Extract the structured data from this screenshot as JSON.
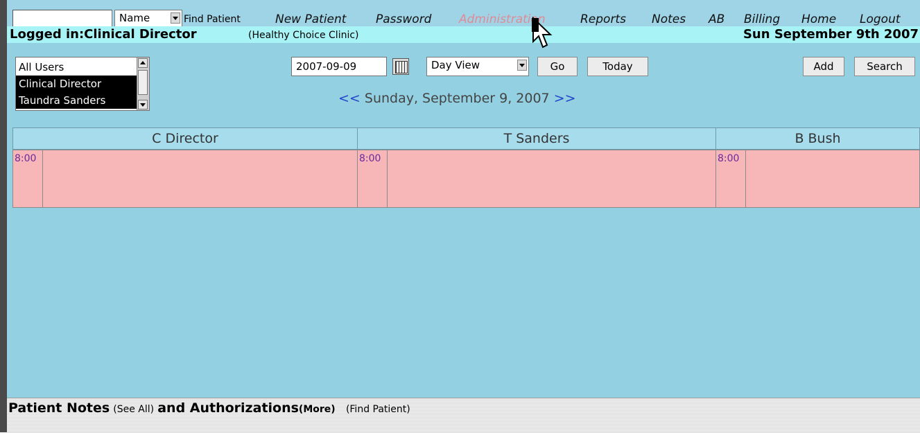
{
  "nav": {
    "search_value": "",
    "search_type": "Name",
    "find_patient": "Find Patient",
    "menu": [
      "New Patient",
      "Password",
      "Administration",
      "Reports",
      "Notes",
      "AB",
      "Billing",
      "Home",
      "Logout"
    ],
    "active_menu": "Administration"
  },
  "login": {
    "label": "Logged in:Clinical Director",
    "clinic": "(Healthy Choice Clinic)",
    "date": "Sun September 9th 2007"
  },
  "toolbar": {
    "users": [
      "All Users",
      "Clinical Director",
      "Taundra Sanders"
    ],
    "date_value": "2007-09-09",
    "view": "Day View",
    "go": "Go",
    "today": "Today",
    "add": "Add",
    "search": "Search"
  },
  "daynav": {
    "prev": "<<",
    "date": "Sunday, September 9, 2007",
    "next": ">>"
  },
  "schedule": {
    "providers": [
      "C Director",
      "T Sanders",
      "B Bush"
    ],
    "first_slot": "8:00"
  },
  "notes": {
    "title": "Patient Notes",
    "see_all": "(See All)",
    "and_auth": "and Authorizations",
    "more": "(More)",
    "find_patient": "(Find Patient)"
  },
  "colors": {
    "nav_bg": "#9ed4e6",
    "login_bg": "#a8f3f6",
    "main_bg": "#92d0e2",
    "slot_bg": "#f7b6b8",
    "active_menu": "#e08a96",
    "time_text": "#6b2a9c"
  }
}
